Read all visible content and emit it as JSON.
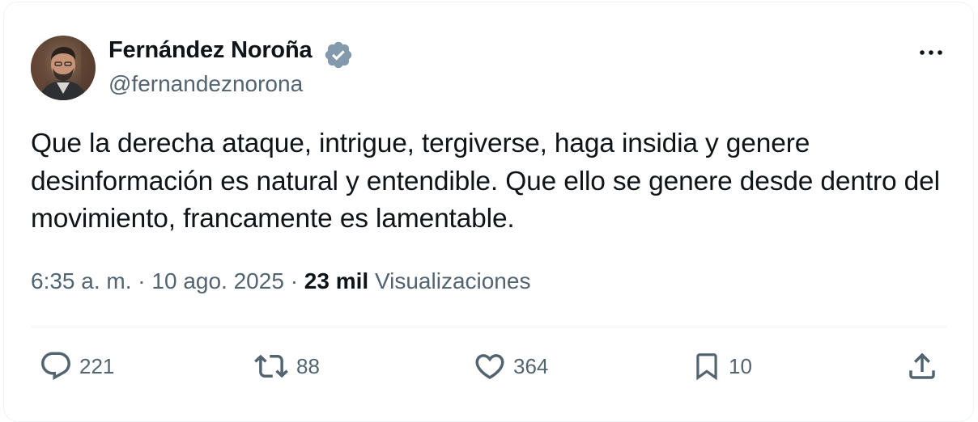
{
  "author": {
    "display_name": "Fernández Noroña",
    "handle": "@fernandeznorona",
    "verified_icon": "verified-badge-icon",
    "verified_color": "#829aab"
  },
  "tweet": {
    "text": "Que la derecha ataque, intrigue, tergiverse, haga insidia y genere desinformación es natural y entendible. Que ello se genere desde dentro del movimiento, francamente es lamentable."
  },
  "meta": {
    "time": "6:35 a. m.",
    "separator": "·",
    "date": "10 ago. 2025",
    "views_count": "23 mil",
    "views_label": "Visualizaciones"
  },
  "actions": {
    "reply": {
      "icon": "reply-icon",
      "count": "221"
    },
    "retweet": {
      "icon": "retweet-icon",
      "count": "88"
    },
    "like": {
      "icon": "heart-icon",
      "count": "364"
    },
    "bookmark": {
      "icon": "bookmark-icon",
      "count": "10"
    },
    "share": {
      "icon": "share-icon"
    }
  },
  "menu": {
    "icon": "more-icon"
  },
  "colors": {
    "text": "#0f1419",
    "secondary": "#536471",
    "divider": "#eff3f4"
  }
}
